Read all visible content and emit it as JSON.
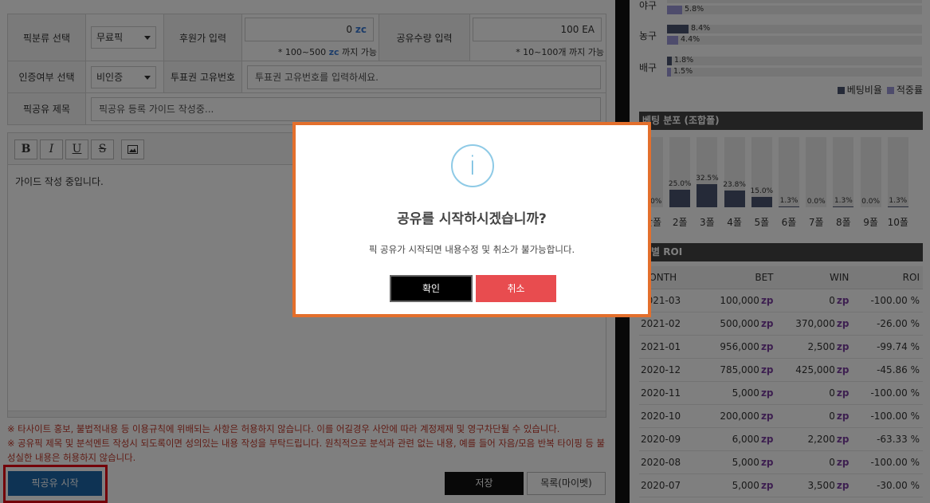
{
  "form": {
    "category_label": "픽분류 선택",
    "category_value": "무료픽",
    "sponsor_label": "후원가 입력",
    "sponsor_value": "0",
    "sponsor_unit": "zc",
    "sponsor_hint_pre": "* 100~500",
    "sponsor_hint_unit": "zc",
    "sponsor_hint_post": "까지 가능",
    "share_qty_label": "공유수량 입력",
    "share_qty_value": "100 EA",
    "share_qty_hint": "* 10~100개 까지 가능",
    "auth_label": "인증여부 선택",
    "auth_value": "비인증",
    "ticket_label": "투표권 고유번호",
    "ticket_placeholder": "투표권 고유번호를 입력하세요.",
    "title_label": "픽공유 제목",
    "title_value": "픽공유 등록 가이드 작성중..."
  },
  "editor": {
    "toolbar": {
      "bold": "B",
      "italic": "I",
      "underline": "U",
      "strike": "S",
      "image": "image-icon"
    },
    "content": "가이드 작성 중입니다."
  },
  "notices": [
    "※ 타사이트 홍보, 불법적내용 등 이용규칙에 위배되는 사항은 허용하지 않습니다. 이를 어길경우 사안에 따라 계정제재 및 영구차단될 수 있습니다.",
    "※ 공유픽 제목 및 분석멘트 작성시 되도록이면 성의있는 내용 작성을 부탁드립니다. 원칙적으로 분석과 관련 없는 내용, 예를 들어 자음/모음 반복 타이핑 등 불성실한 내용은 허용하지 않습니다."
  ],
  "buttons": {
    "start": "픽공유 시작",
    "save": "저장",
    "list": "목록(마이벳)"
  },
  "sport_bars": {
    "rows": [
      {
        "name": "야구",
        "values": [
          "",
          "5.8%"
        ],
        "pct": [
          0,
          5.8
        ]
      },
      {
        "name": "농구",
        "values": [
          "8.4%",
          "4.4%"
        ],
        "pct": [
          8.4,
          4.4
        ]
      },
      {
        "name": "배구",
        "values": [
          "1.8%",
          "1.5%"
        ],
        "pct": [
          1.8,
          1.5
        ]
      }
    ],
    "legend": [
      "베팅비율",
      "적중률"
    ],
    "colors": [
      "#4a5470",
      "#9c99d9"
    ]
  },
  "combo_chart": {
    "title": "베팅 분포 (조합폴)",
    "labels": [
      "단폴",
      "2폴",
      "3폴",
      "4폴",
      "5폴",
      "6폴",
      "7폴",
      "8폴",
      "9폴",
      "10폴"
    ],
    "values": [
      "0.0%",
      "25.0%",
      "32.5%",
      "23.8%",
      "15.0%",
      "1.3%",
      "0.0%",
      "1.3%",
      "0.0%",
      "1.3%"
    ],
    "pct": [
      0.0,
      25.0,
      32.5,
      23.8,
      15.0,
      1.3,
      0.0,
      1.3,
      0.0,
      1.3
    ]
  },
  "roi": {
    "title": "월별 ROI",
    "headers": [
      "MONTH",
      "BET",
      "WIN",
      "ROI"
    ],
    "unit": "zp",
    "rows": [
      [
        "2021-03",
        "100,000",
        "0",
        "-100.00 %"
      ],
      [
        "2021-02",
        "500,000",
        "370,000",
        "-26.00 %"
      ],
      [
        "2021-01",
        "956,000",
        "2,500",
        "-99.74 %"
      ],
      [
        "2020-12",
        "785,000",
        "425,000",
        "-45.86 %"
      ],
      [
        "2020-11",
        "5,000",
        "0",
        "-100.00 %"
      ],
      [
        "2020-10",
        "200,000",
        "0",
        "-100.00 %"
      ],
      [
        "2020-09",
        "6,000",
        "2,200",
        "-63.33 %"
      ],
      [
        "2020-08",
        "5,000",
        "0",
        "-100.00 %"
      ],
      [
        "2020-07",
        "5,000",
        "3,500",
        "-30.00 %"
      ]
    ]
  },
  "modal": {
    "icon": "info-icon",
    "icon_glyph": "i",
    "title": "공유를 시작하시겠습니까?",
    "message": "픽 공유가 시작되면 내용수정 및 취소가 불가능합니다.",
    "confirm": "확인",
    "cancel": "취소"
  }
}
